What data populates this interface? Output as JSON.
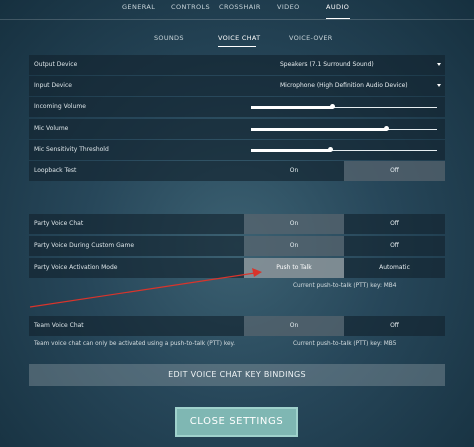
{
  "tabs": [
    {
      "label": "GENERAL"
    },
    {
      "label": "CONTROLS"
    },
    {
      "label": "CROSSHAIR"
    },
    {
      "label": "VIDEO"
    },
    {
      "label": "AUDIO"
    }
  ],
  "active_tab": "AUDIO",
  "subtabs": [
    {
      "label": "SOUNDS"
    },
    {
      "label": "VOICE CHAT"
    },
    {
      "label": "VOICE-OVER"
    }
  ],
  "active_subtab": "VOICE CHAT",
  "settings": {
    "output_device": {
      "label": "Output Device",
      "value": "Speakers (7.1 Surround Sound)"
    },
    "input_device": {
      "label": "Input Device",
      "value": "Microphone (High Definition Audio Device)"
    },
    "incoming_volume": {
      "label": "Incoming Volume",
      "level": 0.44
    },
    "mic_volume": {
      "label": "Mic Volume",
      "level": 0.73
    },
    "mic_sensitivity": {
      "label": "Mic Sensitivity Threshold",
      "level": 0.43
    },
    "loopback_test": {
      "label": "Loopback Test",
      "on": "On",
      "off": "Off",
      "selected": "off"
    },
    "party_voice_chat": {
      "label": "Party Voice Chat",
      "on": "On",
      "off": "Off",
      "selected": "on"
    },
    "party_voice_custom": {
      "label": "Party Voice During Custom Game",
      "on": "On",
      "off": "Off",
      "selected": "on"
    },
    "party_activation_mode": {
      "label": "Party Voice Activation Mode",
      "ptt": "Push to Talk",
      "auto": "Automatic",
      "selected": "ptt"
    },
    "party_ptt_note": "Current push-to-talk (PTT) key: MB4",
    "team_voice_chat": {
      "label": "Team Voice Chat",
      "on": "On",
      "off": "Off",
      "selected": "on"
    },
    "team_note": "Team voice chat can only be activated using a push-to-talk (PTT) key.",
    "team_ptt_note": "Current push-to-talk (PTT) key: MB5"
  },
  "edit_button": "EDIT VOICE CHAT KEY BINDINGS",
  "close_button": "CLOSE SETTINGS",
  "colors": {
    "annotation_arrow": "#d9342b",
    "close_button": "#7fb7b3"
  }
}
